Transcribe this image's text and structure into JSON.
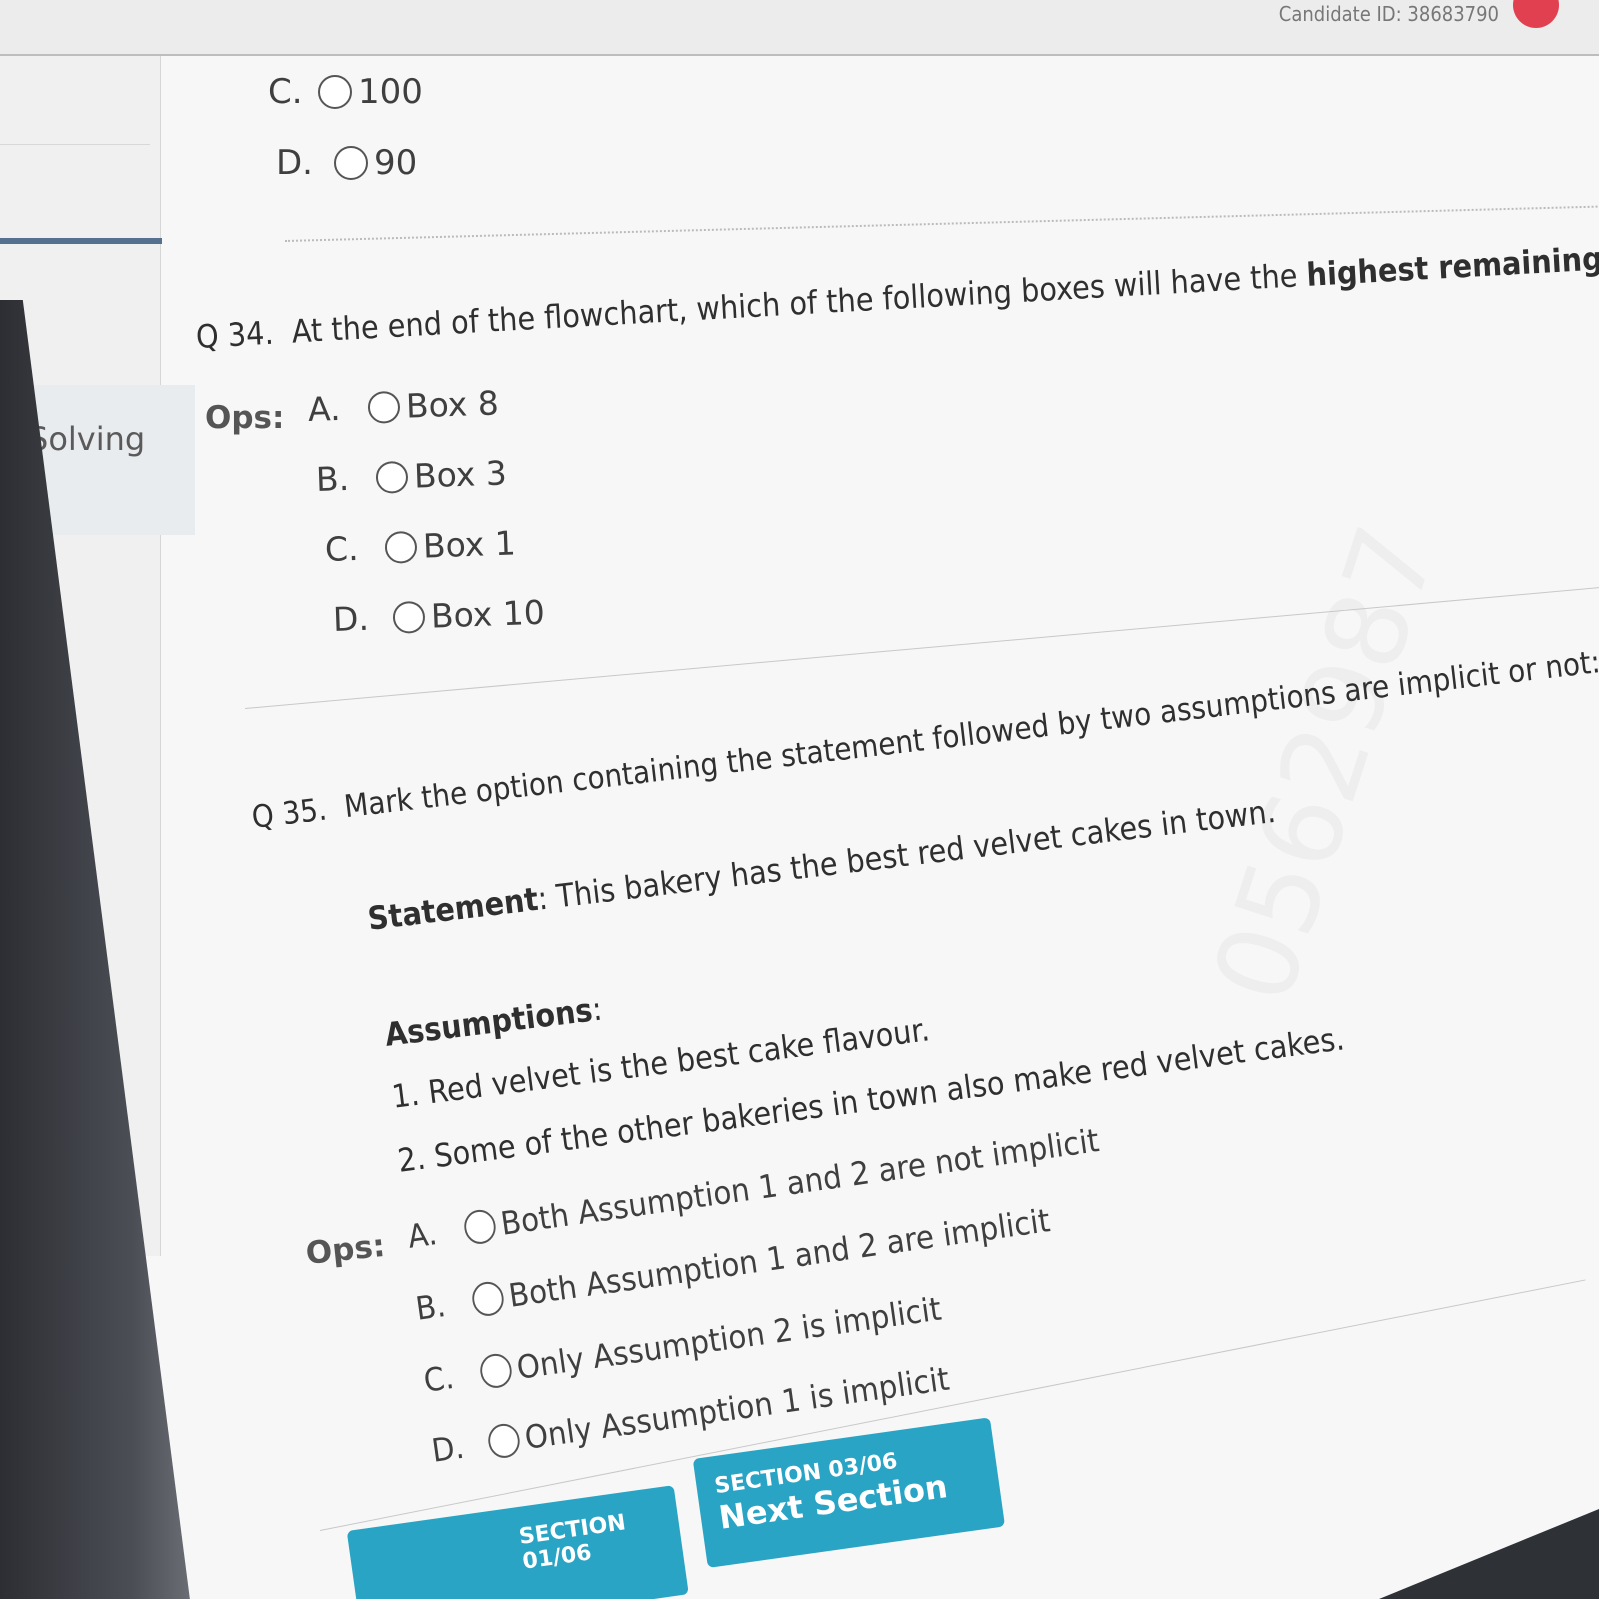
{
  "header": {
    "candidate_label": "Candidate ID: 38683790"
  },
  "sidebar": {
    "active_section": "Solving"
  },
  "prev_question": {
    "options": [
      {
        "letter": "C.",
        "text": "100"
      },
      {
        "letter": "D.",
        "text": "90"
      }
    ]
  },
  "q34": {
    "number": "Q 34.",
    "text_before": "At the end of the flowchart, which of the following boxes will have the ",
    "text_bold": "highest remaining value",
    "text_after": "?",
    "ops_label": "Ops:",
    "options": [
      {
        "letter": "A.",
        "text": "Box 8"
      },
      {
        "letter": "B.",
        "text": "Box 3"
      },
      {
        "letter": "C.",
        "text": "Box 1"
      },
      {
        "letter": "D.",
        "text": "Box 10"
      }
    ]
  },
  "q35": {
    "number": "Q 35.",
    "text": "Mark the option containing the statement followed by two assumptions are implicit or not:",
    "statement_label": "Statement",
    "statement_text": ": This bakery has the best red velvet cakes in town.",
    "assumptions_label": "Assumptions",
    "assumptions_colon": ":",
    "assumptions": [
      "1. Red velvet is the best cake flavour.",
      "2. Some of the other bakeries in town also make red velvet cakes."
    ],
    "ops_label": "Ops:",
    "options": [
      {
        "letter": "A.",
        "text": "Both Assumption 1 and 2 are not implicit"
      },
      {
        "letter": "B.",
        "text": "Both Assumption 1 and 2 are implicit"
      },
      {
        "letter": "C.",
        "text": "Only Assumption 2 is implicit"
      },
      {
        "letter": "D.",
        "text": "Only Assumption 1 is implicit"
      }
    ]
  },
  "nav": {
    "prev_section": {
      "label": "SECTION 01/06"
    },
    "next_section": {
      "label": "SECTION 03/06",
      "title": "Next Section"
    }
  },
  "colors": {
    "nav_button": "#2aa4c4",
    "sidebar_accent": "#56708f",
    "timer_badge": "#e0404f"
  }
}
